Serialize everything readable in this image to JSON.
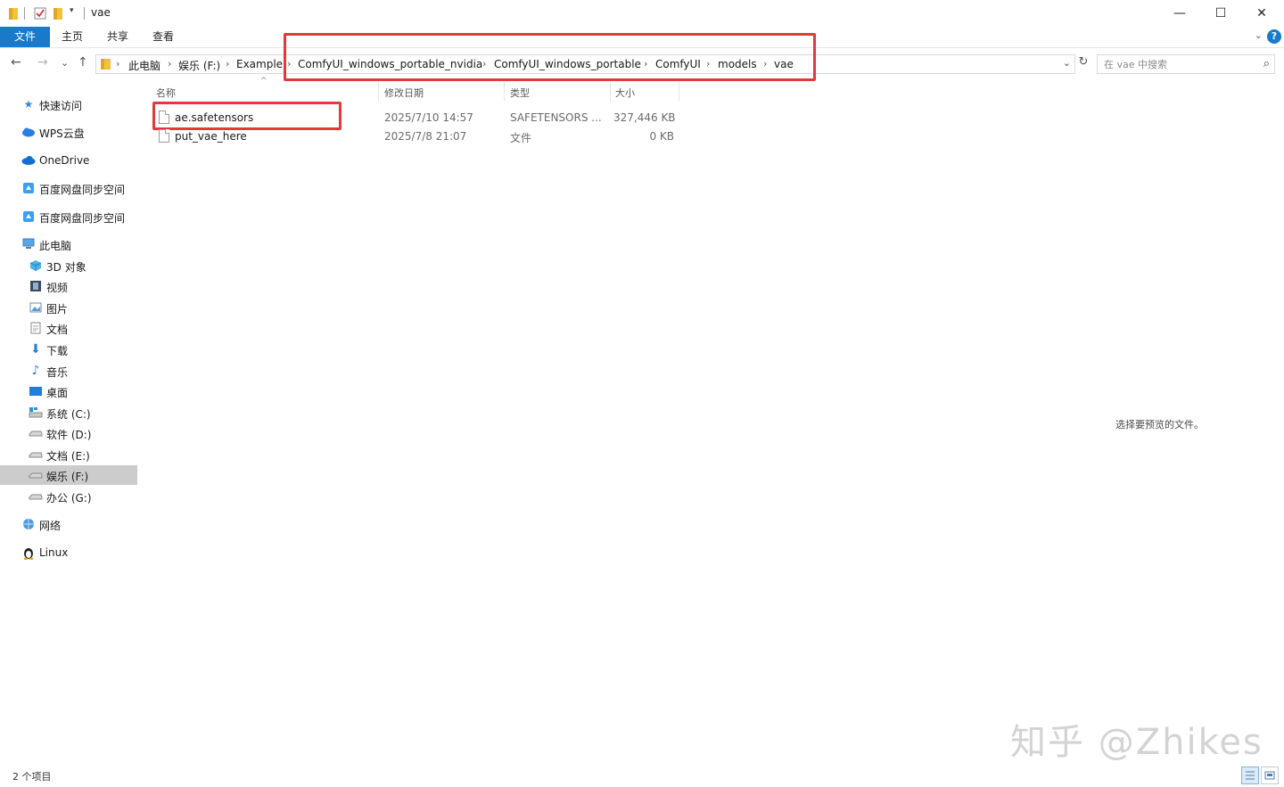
{
  "window": {
    "title": "vae",
    "controls": {
      "minimize": "—",
      "maximize": "☐",
      "close": "✕"
    }
  },
  "ribbon": {
    "tabs": [
      "文件",
      "主页",
      "共享",
      "查看"
    ],
    "collapse_glyph": "⌄",
    "help_glyph": "?"
  },
  "nav": {
    "back": "←",
    "forward": "→",
    "recent": "⌄",
    "up": "↑",
    "crumb_sep": "›",
    "breadcrumbs": [
      "此电脑",
      "娱乐 (F:)",
      "Example",
      "ComfyUI_windows_portable_nvidia",
      "ComfyUI_windows_portable",
      "ComfyUI",
      "models",
      "vae"
    ],
    "dropdown": "⌄",
    "refresh": "↻"
  },
  "search": {
    "placeholder": "在 vae 中搜索",
    "icon": "⌕"
  },
  "sidebar": {
    "items": [
      {
        "label": "快速访问",
        "icon": "star-icon"
      },
      {
        "label": "WPS云盘",
        "icon": "cloud-icon"
      },
      {
        "label": "OneDrive",
        "icon": "onedrive-icon"
      },
      {
        "label": "百度网盘同步空间",
        "icon": "baidu-icon"
      },
      {
        "label": "百度网盘同步空间",
        "icon": "baidu-icon"
      },
      {
        "label": "此电脑",
        "icon": "computer-icon"
      },
      {
        "label": "3D 对象",
        "icon": "cube-icon"
      },
      {
        "label": "视频",
        "icon": "video-icon"
      },
      {
        "label": "图片",
        "icon": "picture-icon"
      },
      {
        "label": "文档",
        "icon": "document-icon"
      },
      {
        "label": "下载",
        "icon": "download-icon"
      },
      {
        "label": "音乐",
        "icon": "music-icon"
      },
      {
        "label": "桌面",
        "icon": "desktop-icon"
      },
      {
        "label": "系统 (C:)",
        "icon": "windows-drive-icon"
      },
      {
        "label": "软件 (D:)",
        "icon": "drive-icon"
      },
      {
        "label": "文档 (E:)",
        "icon": "drive-icon"
      },
      {
        "label": "娱乐 (F:)",
        "icon": "drive-icon",
        "selected": true
      },
      {
        "label": "办公 (G:)",
        "icon": "drive-icon"
      },
      {
        "label": "网络",
        "icon": "network-icon"
      },
      {
        "label": "Linux",
        "icon": "linux-icon"
      }
    ]
  },
  "list": {
    "columns": [
      "名称",
      "修改日期",
      "类型",
      "大小"
    ],
    "sort_caret": "^",
    "rows": [
      {
        "name": "ae.safetensors",
        "date": "2025/7/10 14:57",
        "type": "SAFETENSORS ...",
        "size": "327,446 KB"
      },
      {
        "name": "put_vae_here",
        "date": "2025/7/8 21:07",
        "type": "文件",
        "size": "0 KB"
      }
    ]
  },
  "preview_message": "选择要预览的文件。",
  "status": {
    "item_count": "2 个项目"
  },
  "watermark": "知乎 @Zhikes",
  "colors": {
    "accent": "#1979ca",
    "highlight_box": "#e5383b",
    "selected_nav": "#cccccc"
  }
}
